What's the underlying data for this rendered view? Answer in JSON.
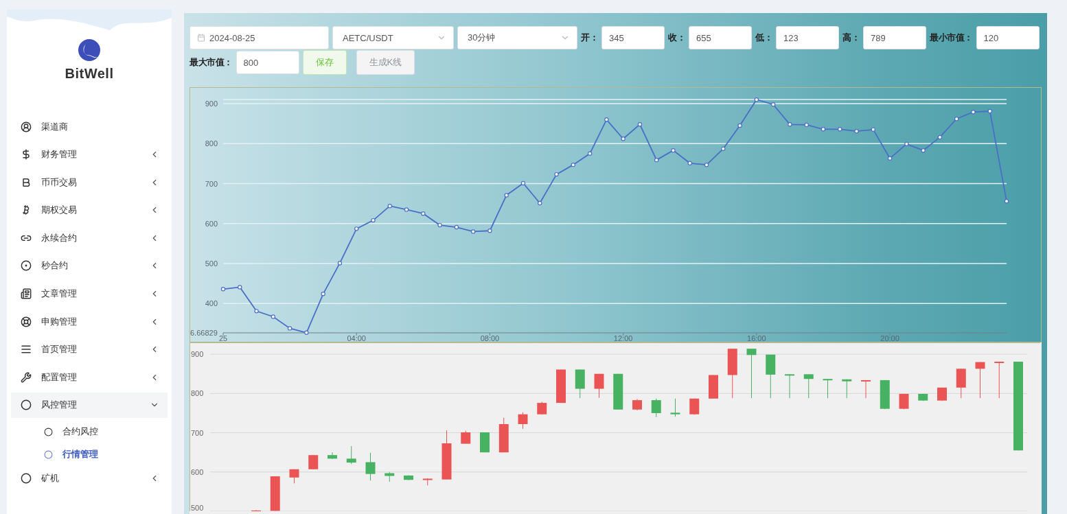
{
  "sidebar": {
    "brand": "BitWell",
    "menu": [
      {
        "label": "渠道商",
        "has_submenu": false,
        "expanded": false
      },
      {
        "label": "财务管理",
        "has_submenu": true,
        "expanded": false
      },
      {
        "label": "币币交易",
        "has_submenu": true,
        "expanded": false
      },
      {
        "label": "期权交易",
        "has_submenu": true,
        "expanded": false
      },
      {
        "label": "永续合约",
        "has_submenu": true,
        "expanded": false
      },
      {
        "label": "秒合约",
        "has_submenu": true,
        "expanded": false
      },
      {
        "label": "文章管理",
        "has_submenu": true,
        "expanded": false
      },
      {
        "label": "申购管理",
        "has_submenu": true,
        "expanded": false
      },
      {
        "label": "首页管理",
        "has_submenu": true,
        "expanded": false
      },
      {
        "label": "配置管理",
        "has_submenu": true,
        "expanded": false
      },
      {
        "label": "风控管理",
        "has_submenu": true,
        "expanded": true,
        "children": [
          {
            "label": "合约风控",
            "selected": false
          },
          {
            "label": "行情管理",
            "selected": true
          }
        ]
      },
      {
        "label": "矿机",
        "has_submenu": true,
        "expanded": false
      }
    ]
  },
  "toolbar": {
    "date": {
      "value": "2024-08-25"
    },
    "pair": {
      "value": "AETC/USDT"
    },
    "interval": {
      "value": "30分钟"
    },
    "fields": [
      {
        "label": "开：",
        "value": "345"
      },
      {
        "label": "收：",
        "value": "655"
      },
      {
        "label": "低：",
        "value": "123"
      },
      {
        "label": "高：",
        "value": "789"
      },
      {
        "label": "最小市值：",
        "value": "120"
      },
      {
        "label": "最大市值：",
        "value": "800"
      }
    ],
    "buttons": [
      {
        "label": "保存",
        "kind": "primary"
      },
      {
        "label": "生成K线",
        "kind": "default"
      }
    ]
  },
  "line_chart": {
    "y_min_label": "6.66829",
    "x_start_label": "25",
    "chart_data": {
      "type": "line",
      "x": [
        0,
        0.5,
        1,
        1.5,
        2,
        2.5,
        3,
        3.5,
        4,
        4.5,
        5,
        5.5,
        6,
        6.5,
        7,
        7.5,
        8,
        8.5,
        9,
        9.5,
        10,
        10.5,
        11,
        11.5,
        12,
        12.5,
        13,
        13.5,
        14,
        14.5,
        15,
        15.5,
        16,
        16.5,
        17,
        17.5,
        18,
        18.5,
        19,
        19.5,
        20,
        20.5,
        21,
        21.5,
        22,
        22.5,
        23,
        23.5
      ],
      "series": [
        {
          "color": "#4a6fc6",
          "marker": true,
          "values": [
            436,
            441,
            381,
            367,
            338,
            327,
            424,
            501,
            587,
            608,
            644,
            635,
            625,
            596,
            591,
            580,
            582,
            671,
            701,
            651,
            723,
            747,
            775,
            860,
            812,
            848,
            759,
            783,
            751,
            747,
            787,
            845,
            910,
            898,
            848,
            847,
            836,
            836,
            831,
            835,
            763,
            799,
            783,
            816,
            862,
            879,
            881,
            656
          ]
        }
      ],
      "grid": true,
      "xlim": [
        0,
        23.5
      ],
      "ylim": [
        326.66829,
        910.3
      ],
      "yticks": [
        400,
        500,
        600,
        700,
        800,
        900
      ],
      "xticks": [
        {
          "value": 4,
          "label": "04:00"
        },
        {
          "value": 8,
          "label": "08:00"
        },
        {
          "value": 12,
          "label": "12:00"
        },
        {
          "value": 16,
          "label": "16:00"
        },
        {
          "value": 20,
          "label": "20:00"
        }
      ]
    }
  },
  "candle_chart": {
    "chart_data": {
      "type": "candlestick",
      "grid": true,
      "ylim": [
        500,
        930
      ],
      "yticks": [
        500,
        600,
        700,
        800,
        900
      ],
      "categories": [
        null,
        null,
        null,
        null,
        null,
        null,
        null,
        null,
        null,
        null,
        null,
        null,
        null,
        null,
        null,
        null,
        null,
        null,
        null,
        null,
        null,
        null,
        null,
        null,
        null,
        null,
        null,
        null,
        null,
        null,
        null,
        null,
        null,
        null,
        null,
        null,
        null,
        null,
        null,
        null,
        null
      ],
      "ohlc": [
        [
          500,
          503,
          500,
          502
        ],
        [
          501,
          589,
          501,
          589
        ],
        [
          586,
          607,
          571,
          607
        ],
        [
          607,
          643,
          607,
          643
        ],
        [
          643,
          650,
          633,
          634
        ],
        [
          634,
          666,
          620,
          624
        ],
        [
          625,
          649,
          578,
          595
        ],
        [
          597,
          600,
          575,
          590
        ],
        [
          591,
          592,
          579,
          580
        ],
        [
          580,
          584,
          566,
          583
        ],
        [
          581,
          706,
          581,
          673
        ],
        [
          672,
          705,
          672,
          701
        ],
        [
          701,
          701,
          650,
          650
        ],
        [
          650,
          738,
          650,
          722
        ],
        [
          722,
          752,
          710,
          747
        ],
        [
          747,
          779,
          746,
          776
        ],
        [
          776,
          861,
          776,
          861
        ],
        [
          861,
          861,
          788,
          812
        ],
        [
          812,
          850,
          789,
          850
        ],
        [
          850,
          850,
          759,
          759
        ],
        [
          759,
          786,
          757,
          783
        ],
        [
          783,
          787,
          740,
          750
        ],
        [
          751,
          787,
          741,
          747
        ],
        [
          747,
          787,
          746,
          787
        ],
        [
          787,
          847,
          787,
          847
        ],
        [
          847,
          914,
          788,
          914
        ],
        [
          914,
          914,
          788,
          898
        ],
        [
          899,
          899,
          788,
          848
        ],
        [
          849,
          849,
          788,
          846
        ],
        [
          849,
          849,
          788,
          837
        ],
        [
          837,
          837,
          788,
          836
        ],
        [
          836,
          836,
          788,
          831
        ],
        [
          831,
          834,
          788,
          834
        ],
        [
          834,
          834,
          760,
          761
        ],
        [
          761,
          799,
          760,
          799
        ],
        [
          799,
          799,
          781,
          782
        ],
        [
          782,
          815,
          781,
          815
        ],
        [
          815,
          863,
          788,
          863
        ],
        [
          863,
          880,
          788,
          880
        ],
        [
          880,
          881,
          788,
          881
        ],
        [
          881,
          881,
          655,
          655
        ]
      ]
    }
  }
}
